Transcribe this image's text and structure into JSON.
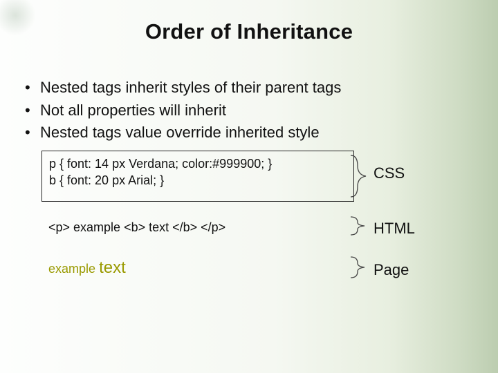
{
  "title": "Order of Inheritance",
  "bullets": [
    "Nested tags inherit styles of their parent tags",
    "Not all properties will inherit",
    "Nested tags value override inherited style"
  ],
  "css_box": {
    "line1": "p {  font: 14 px Verdana; color:#999900; }",
    "line2": "b {  font: 20 px Arial; }"
  },
  "html_box": "<p> example  <b> text </b> </p>",
  "page_box": {
    "example": "example",
    "text": "text"
  },
  "labels": {
    "css": "CSS",
    "html": "HTML",
    "page": "Page"
  }
}
